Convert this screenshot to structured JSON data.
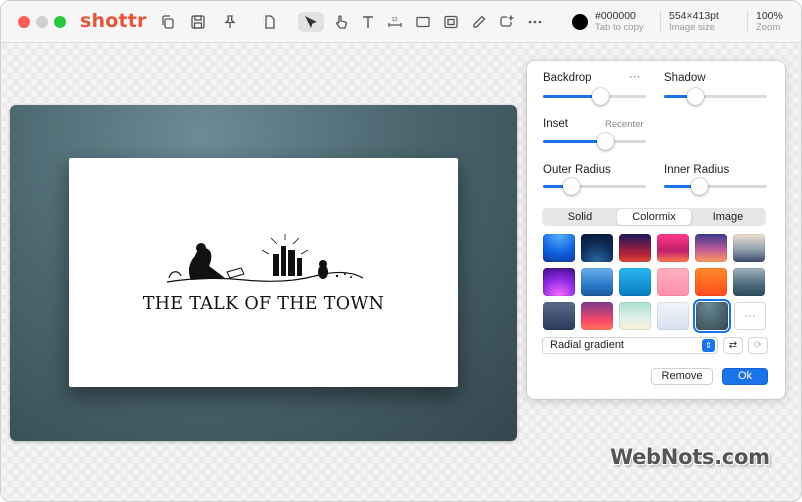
{
  "app": {
    "name": "shottr"
  },
  "toolbar": {
    "icons": [
      "copy-icon",
      "save-icon",
      "pin-icon",
      "crop-icon",
      "select-arrow-icon",
      "hand-pointer-icon",
      "text-icon",
      "ruler-icon",
      "rectangle-icon",
      "frame-icon",
      "pen-icon",
      "add-image-icon",
      "more-icon"
    ],
    "ruler_label": "12",
    "color_hex": "#000000",
    "color_sub": "Tab to copy",
    "image_size": "554×413pt",
    "image_size_sub": "Image size",
    "zoom": "100%",
    "zoom_sub": "Zoom"
  },
  "canvas": {
    "image_title": "THE TALK OF THE TOWN"
  },
  "panel": {
    "backdrop_label": "Backdrop",
    "backdrop_more": "···",
    "shadow_label": "Shadow",
    "inset_label": "Inset",
    "recenter_label": "Recenter",
    "outer_radius_label": "Outer Radius",
    "inner_radius_label": "Inner Radius",
    "sliders": {
      "backdrop": 0.55,
      "shadow": 0.3,
      "inset": 0.6,
      "outer_radius": 0.27,
      "inner_radius": 0.34
    },
    "tabs": [
      "Solid",
      "Colormix",
      "Image"
    ],
    "active_tab": "Colormix",
    "swatch_more": "···",
    "gradient_type": "Radial gradient",
    "remove_label": "Remove",
    "ok_label": "Ok",
    "colors": {
      "accent": "#1a73e8"
    }
  },
  "watermark": "WebNots.com"
}
